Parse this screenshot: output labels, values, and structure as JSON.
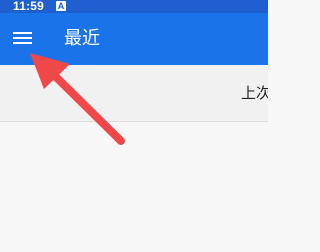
{
  "status_bar": {
    "time": "11:59",
    "indicator_icon": "a-icon",
    "indicator_text": "A"
  },
  "app_bar": {
    "title": "最近",
    "menu_icon": "hamburger-menu-icon"
  },
  "subheader": {
    "text": "上次"
  },
  "colors": {
    "status_bar": "#1f5fd0",
    "app_bar": "#1a73e8",
    "annotation_arrow": "#f04848",
    "background": "#f7f7f7"
  }
}
